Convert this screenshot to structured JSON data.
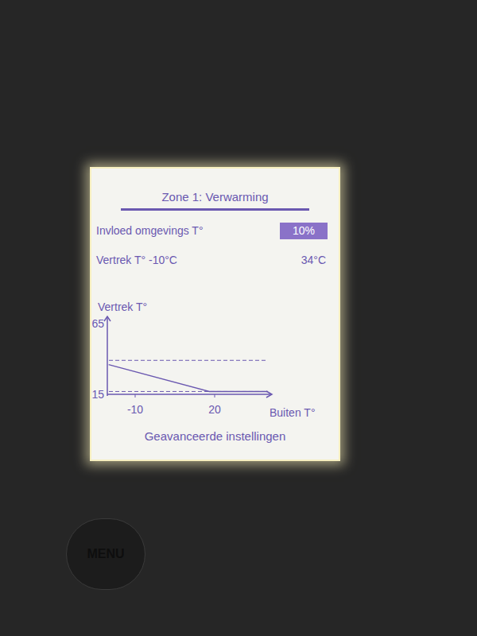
{
  "screen": {
    "title": "Zone 1: Verwarming",
    "settings": [
      {
        "label": "Invloed omgevings T°",
        "value": "10%",
        "selected": true
      },
      {
        "label": "Vertrek T° -10°C",
        "value": "34°C",
        "selected": false
      }
    ],
    "chart": {
      "y_label": "Vertrek T°",
      "y_ticks": [
        "65",
        "15"
      ],
      "x_ticks": [
        "-10",
        "20"
      ],
      "x_label": "Buiten T°",
      "heating_curve": {
        "x": [
          -20,
          18,
          40
        ],
        "y": [
          36,
          17,
          17
        ]
      },
      "limits": [
        {
          "name": "max",
          "y": 39
        },
        {
          "name": "min",
          "y": 17
        }
      ]
    },
    "link": "Geavanceerde instellingen"
  },
  "buttons": [
    "MENU"
  ]
}
